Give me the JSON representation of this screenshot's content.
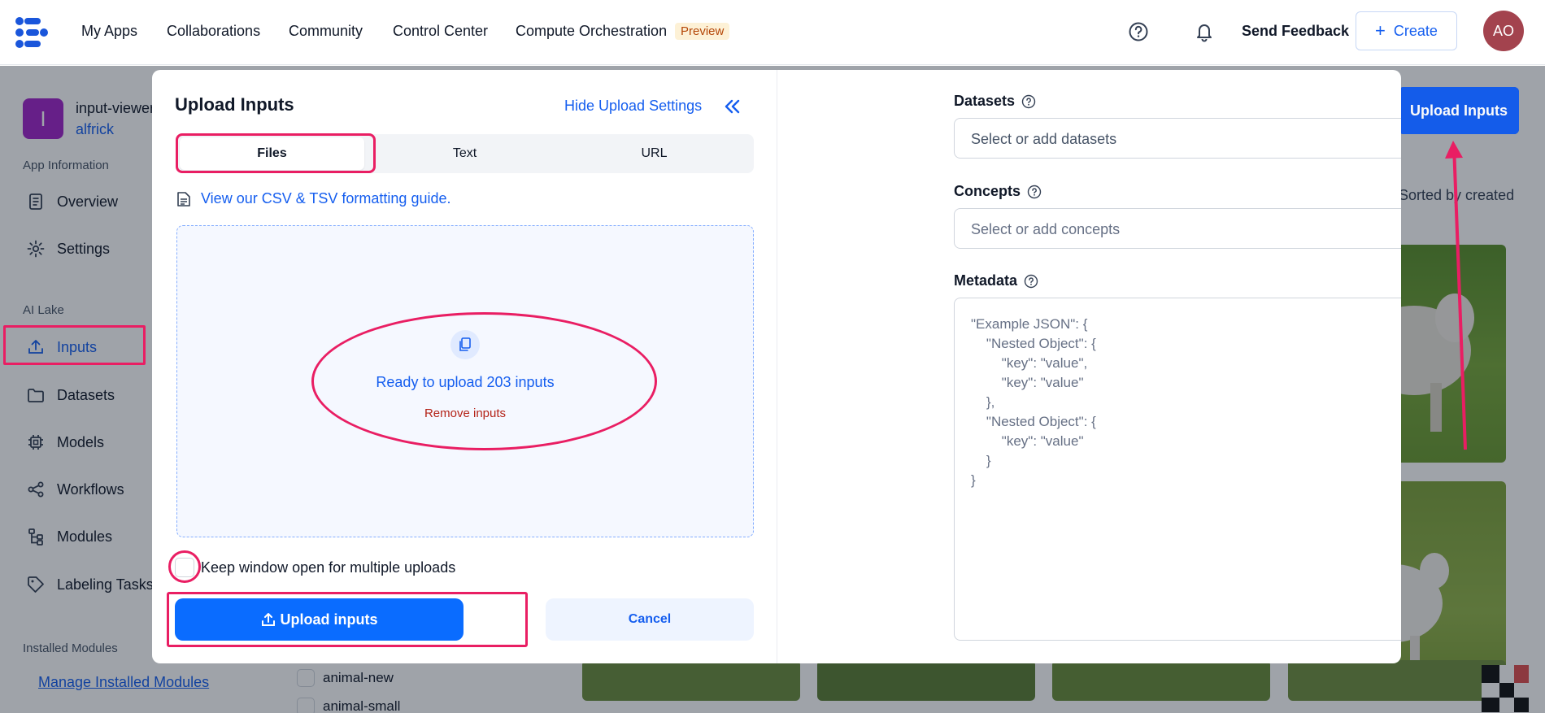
{
  "topnav": {
    "items": [
      "My Apps",
      "Collaborations",
      "Community",
      "Control Center",
      "Compute Orchestration"
    ],
    "preview_badge": "Preview",
    "send_feedback": "Send Feedback",
    "create_label": "Create",
    "avatar_initials": "AO"
  },
  "sidebar": {
    "app_initial": "I",
    "app_name": "input-viewer",
    "app_owner": "alfrick",
    "section_app_info": "App Information",
    "overview": "Overview",
    "settings": "Settings",
    "section_ai_lake": "AI Lake",
    "inputs": "Inputs",
    "datasets": "Datasets",
    "models": "Models",
    "workflows": "Workflows",
    "modules": "Modules",
    "labeling_tasks": "Labeling Tasks",
    "section_installed": "Installed Modules",
    "manage_link": "Manage Installed Modules"
  },
  "background": {
    "upload_inputs_button": "Upload Inputs",
    "sorted_text": "Sorted by created",
    "list_items": [
      "animal-new",
      "animal-small"
    ]
  },
  "modal": {
    "title": "Upload Inputs",
    "hide_settings": "Hide Upload Settings",
    "tabs": [
      "Files",
      "Text",
      "URL"
    ],
    "active_tab": "Files",
    "guide_link": "View our CSV & TSV formatting guide.",
    "ready_text": "Ready to upload 203 inputs",
    "remove_text": "Remove inputs",
    "keep_open_label": "Keep window open for multiple uploads",
    "keep_open_checked": false,
    "upload_button": "Upload inputs",
    "cancel_button": "Cancel",
    "datasets_label": "Datasets",
    "datasets_placeholder": "Select or add datasets",
    "concepts_label": "Concepts",
    "concepts_placeholder": "Select or add concepts",
    "metadata_label": "Metadata",
    "metadata_placeholder": "\"Example JSON\": {\n\t\"Nested Object\": {\n\t\t\"key\": \"value\",\n\t\t\"key\": \"value\"\n\t},\n\t\"Nested Object\": {\n\t\t\"key\": \"value\"\n\t}\n}"
  },
  "colors": {
    "accent": "#155eef",
    "primary_button": "#0a6cff",
    "annotation": "#e91e63",
    "danger": "#b42318"
  }
}
